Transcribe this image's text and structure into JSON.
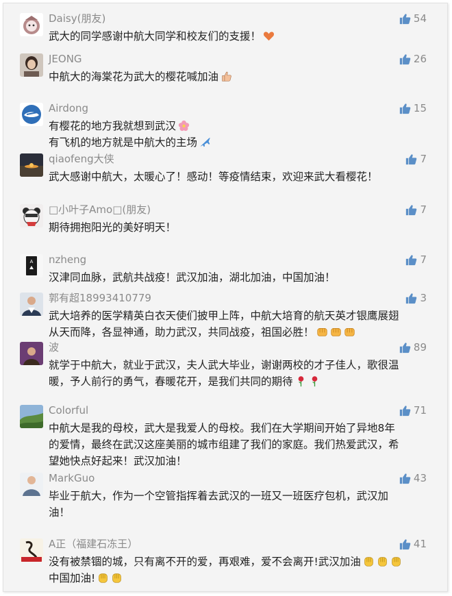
{
  "comments": [
    {
      "nick": "Daisy(朋友)",
      "likes": "54",
      "lines": [
        "武大的同学感谢中航大同学和校友们的支援！"
      ],
      "emoji": "heart-emoji"
    },
    {
      "nick": "JEONG",
      "likes": "26",
      "lines": [
        "中航大的海棠花为武大的樱花喊加油"
      ],
      "emoji": "thumbs-up-emoji"
    },
    {
      "nick": "Airdong",
      "likes": "15",
      "lines": [
        "有樱花的地方我就想到武汉",
        "有飞机的地方就是中航大的主场"
      ],
      "emoji": "flower-emoji",
      "emoji2": "airplane-emoji"
    },
    {
      "nick": "qiaofeng大侠",
      "likes": "7",
      "lines": [
        "武大感谢中航大，太暖心了！感动！等疫情结束，欢迎来武大看樱花！"
      ]
    },
    {
      "nick": "□小叶子Amo□(朋友)",
      "likes": "7",
      "lines": [
        "期待拥抱阳光的美好明天！"
      ]
    },
    {
      "nick": "nzheng",
      "likes": "7",
      "lines": [
        "汉津同血脉，武航共战疫！武汉加油，湖北加油，中国加油！"
      ]
    },
    {
      "nick": "郭有超18993410779",
      "likes": "3",
      "lines": [
        "武大培养的医学精英白衣天使们披甲上阵，中航大培育的航天英才银鹰展翅",
        "从天而降，各显神通，助力武汉，共同战疫，祖国必胜！"
      ],
      "emoji": "fist-emoji"
    },
    {
      "nick": "波",
      "likes": "89",
      "lines": [
        "就学于中航大，就业于武汉，夫人武大毕业，谢谢两校的才子佳人，歌很温",
        "暖，予人前行的勇气，春暖花开，是我们共同的期待"
      ],
      "emoji": "rose-emoji"
    },
    {
      "nick": "Colorful",
      "likes": "71",
      "lines": [
        "中航大是我的母校，武大是我爱人的母校。我们在大学期间开始了异地8年",
        "的爱情，最终在武汉这座美丽的城市组建了我们的家庭。我们热爱武汉，希",
        "望她快点好起来！武汉加油！"
      ]
    },
    {
      "nick": "MarkGuo",
      "likes": "43",
      "lines": [
        "毕业于航大，作为一个空管指挥着去武汉的一班又一班医疗包机，武汉加",
        "油！"
      ]
    },
    {
      "nick": "A正（福建石冻王）",
      "likes": "41",
      "lines": [
        "没有被禁锢的城，只有离不开的爱，再艰难，爱不会离开!武汉加油",
        "中国加油!"
      ],
      "emoji": "cheer-emoji"
    }
  ]
}
